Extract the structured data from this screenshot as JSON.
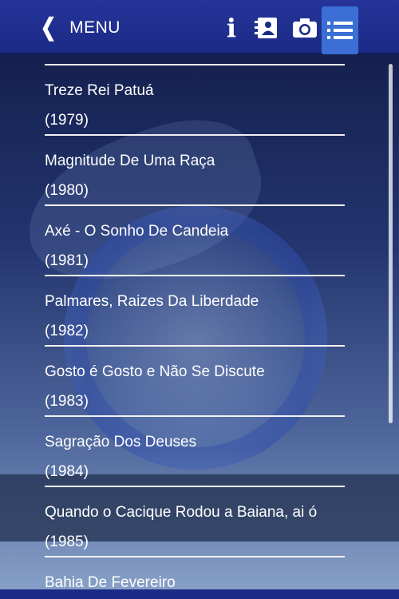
{
  "header": {
    "back_label": "MENU",
    "info_label": "i",
    "accent": "#3b6fd6",
    "bar_color": "#1b2a86"
  },
  "icons": [
    "chevron-left-icon",
    "info-icon",
    "contacts-icon",
    "camera-icon",
    "list-icon"
  ],
  "list": {
    "items": [
      {
        "title": "Treze Rei Patuá",
        "year": "(1979)"
      },
      {
        "title": "Magnitude De Uma Raça",
        "year": "(1980)"
      },
      {
        "title": "Axé - O Sonho De Candeia",
        "year": "(1981)"
      },
      {
        "title": "Palmares, Raizes Da Liberdade",
        "year": "(1982)"
      },
      {
        "title": "Gosto é Gosto e Não Se Discute",
        "year": "(1983)"
      },
      {
        "title": "Sagração Dos Deuses",
        "year": "(1984)"
      },
      {
        "title": "Quando o Cacique Rodou a Baiana, ai ó",
        "year": "(1985)"
      },
      {
        "title": "Bahia De Fevereiro",
        "year": ""
      }
    ]
  }
}
